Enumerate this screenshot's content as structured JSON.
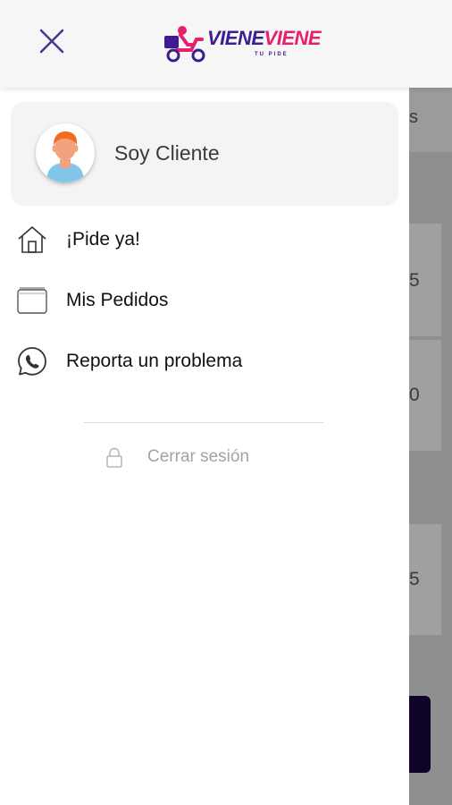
{
  "header": {
    "logo": {
      "word1": "VIENE",
      "word2": "VIENE",
      "tagline": "TU PIDE"
    },
    "close_icon": "close-icon"
  },
  "drawer": {
    "profile": {
      "name": "Soy Cliente",
      "avatar_icon": "user-avatar-icon"
    },
    "menu": [
      {
        "label": "¡Pide ya!",
        "icon": "home-icon"
      },
      {
        "label": "Mis Pedidos",
        "icon": "orders-icon"
      },
      {
        "label": "Reporta un problema",
        "icon": "whatsapp-icon"
      }
    ],
    "logout": {
      "label": "Cerrar sesión",
      "icon": "lock-icon"
    }
  },
  "background": {
    "tab_fragment": "s",
    "card_fragments": [
      "5",
      "0",
      "5"
    ]
  },
  "colors": {
    "brand_purple": "#3d1d8f",
    "brand_pink": "#e5206f",
    "close_icon": "#4b3a8c",
    "overlay": "#8f8f8f",
    "dark_button": "#100528"
  }
}
